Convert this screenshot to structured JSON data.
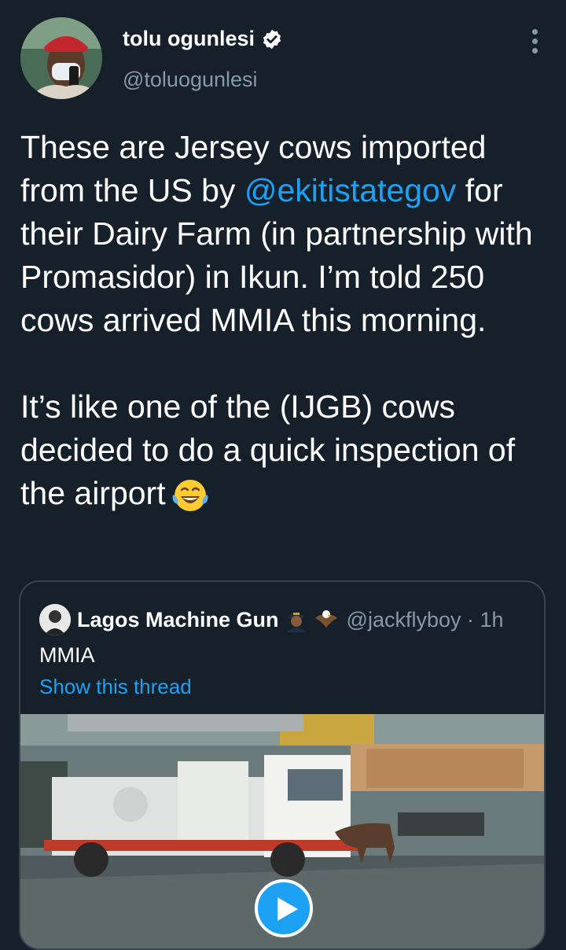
{
  "author": {
    "name": "tolu ogunlesi",
    "handle": "@toluogunlesi"
  },
  "tweet": {
    "p1_before": "These are Jersey cows imported from the US by ",
    "p1_mention": "@ekitistategov",
    "p1_after": " for their Dairy Farm (in partnership with Promasidor) in Ikun. I’m told 250 cows arrived MMIA this morning.",
    "p2": "It’s like one of the (IJGB) cows decided to do a quick inspection of the airport"
  },
  "quoted": {
    "name": "Lagos Machine Gun",
    "handle": "@jackflyboy · 1h",
    "text": "MMIA",
    "show_thread": "Show this thread"
  },
  "icons": {
    "verified": "verified-badge-icon",
    "more": "more-vertical-icon",
    "emoji": "face-with-tears-of-joy-icon",
    "play": "play-icon"
  },
  "colors": {
    "background": "#15202b",
    "link": "#1da1f2",
    "secondary_text": "#8899a6",
    "border": "#38444d"
  }
}
